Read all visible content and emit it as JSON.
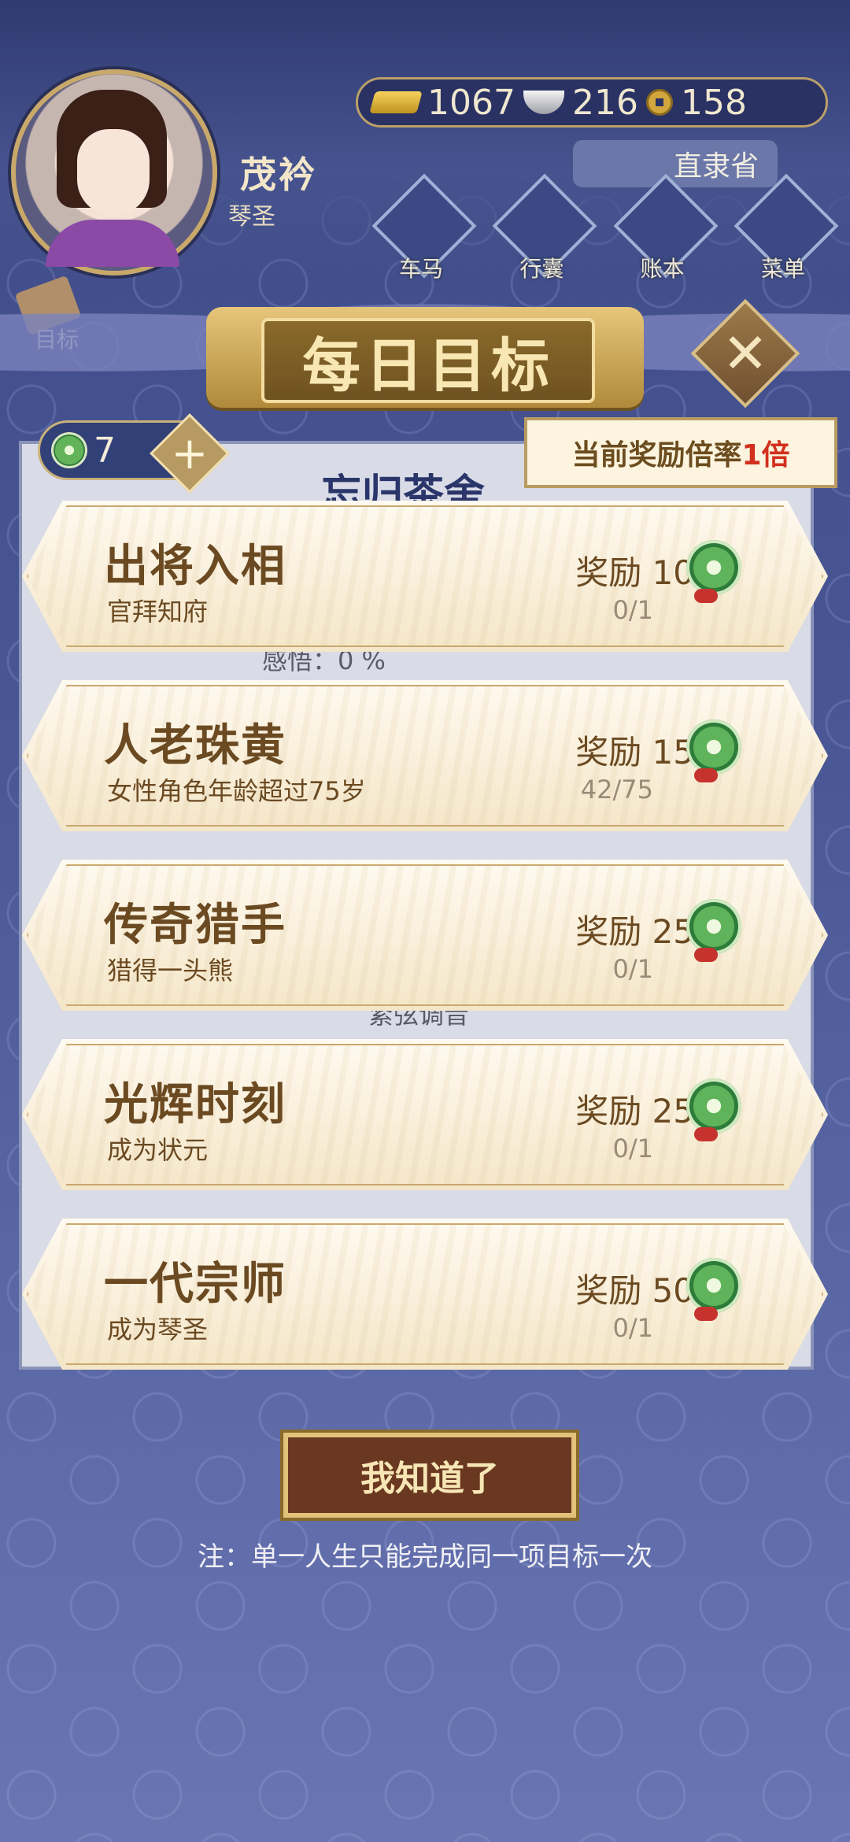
{
  "player": {
    "name": "茂衿",
    "title": "琴圣"
  },
  "currency": {
    "gold": "1067",
    "silver": "216",
    "coin": "158"
  },
  "location": "直隶省",
  "nav": [
    {
      "label": "车马",
      "icon": "carriage-icon"
    },
    {
      "label": "行囊",
      "icon": "bag-icon"
    },
    {
      "label": "账本",
      "icon": "ledger-icon"
    },
    {
      "label": "菜单",
      "icon": "menu-icon"
    }
  ],
  "side": {
    "goal_label": "目标"
  },
  "dialog": {
    "title": "每日目标",
    "jade_count": "7",
    "multiplier_prefix": "当前奖励倍率",
    "multiplier_value": "1倍",
    "background_shop": "忘归茶舍",
    "background_text1": "感悟：0 %",
    "background_text2": "紧弦调音",
    "goals": [
      {
        "title": "出将入相",
        "desc": "官拜知府",
        "reward": "奖励 10",
        "progress": "0/1"
      },
      {
        "title": "人老珠黄",
        "desc": "女性角色年龄超过75岁",
        "reward": "奖励 15",
        "progress": "42/75"
      },
      {
        "title": "传奇猎手",
        "desc": "猎得一头熊",
        "reward": "奖励 25",
        "progress": "0/1"
      },
      {
        "title": "光辉时刻",
        "desc": "成为状元",
        "reward": "奖励 25",
        "progress": "0/1"
      },
      {
        "title": "一代宗师",
        "desc": "成为琴圣",
        "reward": "奖励 50",
        "progress": "0/1"
      }
    ],
    "confirm_label": "我知道了",
    "note": "注：单一人生只能完成同一项目标一次"
  }
}
